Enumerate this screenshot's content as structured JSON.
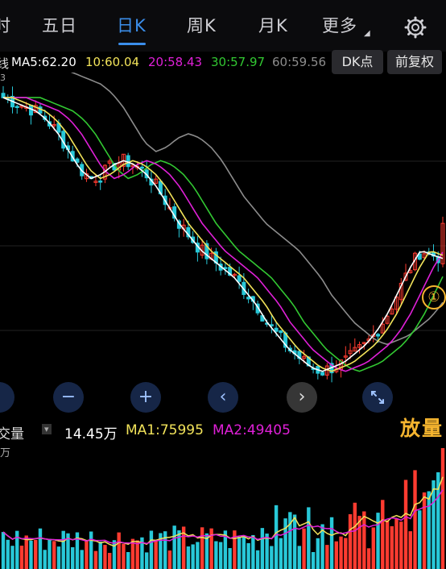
{
  "tabs": [
    {
      "label": "时"
    },
    {
      "label": "五日"
    },
    {
      "label": "日K"
    },
    {
      "label": "周K"
    },
    {
      "label": "月K"
    },
    {
      "label": "更多"
    }
  ],
  "ma_bar": {
    "prefix": "线",
    "ma5": "MA5:62.20",
    "ma10": "10:60.04",
    "ma20": "20:58.43",
    "ma30": "30:57.97",
    "ma60": "60:59.56",
    "dk_button": "DK点",
    "fq_button": "前复权"
  },
  "top_axis_label": "3",
  "controls": {
    "minus": "−",
    "plus": "+",
    "prev": "‹",
    "next": "›"
  },
  "vol_bar": {
    "title": "交量",
    "dropdown_arrow": "▾",
    "value": "14.45万",
    "ma1": "MA1:75995",
    "ma2": "MA2:49405",
    "unit": "万"
  },
  "annotation": {
    "marker": "①",
    "label": "放量"
  },
  "colors": {
    "up": "#ff3b30",
    "down": "#28c8d8",
    "ma5": "#ffffff",
    "ma10": "#f2e35a",
    "ma20": "#e020d8",
    "ma30": "#32c832",
    "ma60": "#8c8c8c",
    "active_tab": "#3b8eea",
    "annotation": "#f6b52f"
  },
  "chart_data": [
    {
      "type": "candlestick",
      "title": "日K",
      "series": [
        {
          "name": "MA5",
          "value": 62.2
        },
        {
          "name": "MA10",
          "value": 60.04
        },
        {
          "name": "MA20",
          "value": 58.43
        },
        {
          "name": "MA30",
          "value": 57.97
        },
        {
          "name": "MA60",
          "value": 59.56
        }
      ],
      "close_trend": [
        98,
        97,
        96,
        95,
        93,
        90,
        86,
        82,
        80,
        81,
        83,
        84,
        83,
        81,
        78,
        74,
        70,
        67,
        64,
        62,
        60,
        58,
        55,
        52,
        48,
        45,
        42,
        40,
        38,
        37,
        38,
        39,
        41,
        43,
        46,
        50,
        55,
        60,
        64,
        63,
        62.2
      ]
    },
    {
      "type": "bar",
      "title": "成交量",
      "series": [
        {
          "name": "VOL",
          "value": 144500
        },
        {
          "name": "MA1",
          "value": 75995
        },
        {
          "name": "MA2",
          "value": 49405
        }
      ]
    }
  ]
}
